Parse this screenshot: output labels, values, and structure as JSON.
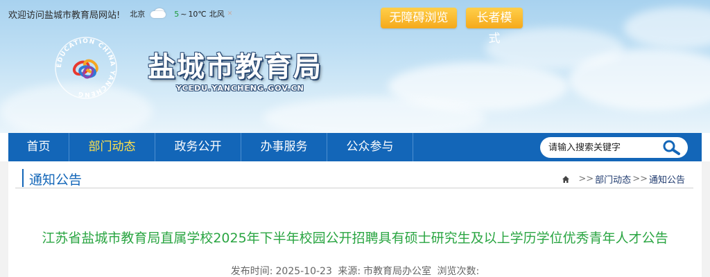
{
  "header": {
    "welcome": "欢迎访问盐城市教育局网站!",
    "weather": {
      "city": "北京",
      "temp_low": "5",
      "temp_sep": "~",
      "temp_high": "10℃",
      "wind": "北风",
      "icon": "cloudy-icon"
    },
    "accessibility_btn": "无障碍浏览",
    "elder_btn": "长者模式",
    "site_title": "盐城市教育局",
    "site_domain": "YCEDU.YANCHENG.GOV.CN",
    "logo_text_outer": "EDUCATION CHINA YANCHENG"
  },
  "nav": {
    "items": [
      {
        "label": "首页",
        "active": false
      },
      {
        "label": "部门动态",
        "active": true
      },
      {
        "label": "政务公开",
        "active": false
      },
      {
        "label": "办事服务",
        "active": false
      },
      {
        "label": "公众参与",
        "active": false
      }
    ],
    "search_placeholder": "请输入搜索关键字"
  },
  "section": {
    "title": "通知公告",
    "breadcrumb": {
      "sep": ">>",
      "items": [
        "部门动态",
        "通知公告"
      ]
    }
  },
  "article": {
    "title": "江苏省盐城市教育局直属学校2025年下半年校园公开招聘具有硕士研究生及以上学历学位优秀青年人才公告",
    "meta": {
      "publish_label": "发布时间:",
      "publish_date": "2025-10-23",
      "source_label": "来源:",
      "source": "市教育局办公室",
      "views_label": "浏览次数:"
    }
  },
  "colors": {
    "nav_bg": "#1366b8",
    "nav_active": "#ffe14d",
    "button_orange": "#f5a91b",
    "title_green": "#2aa542",
    "section_blue": "#1366b8"
  }
}
